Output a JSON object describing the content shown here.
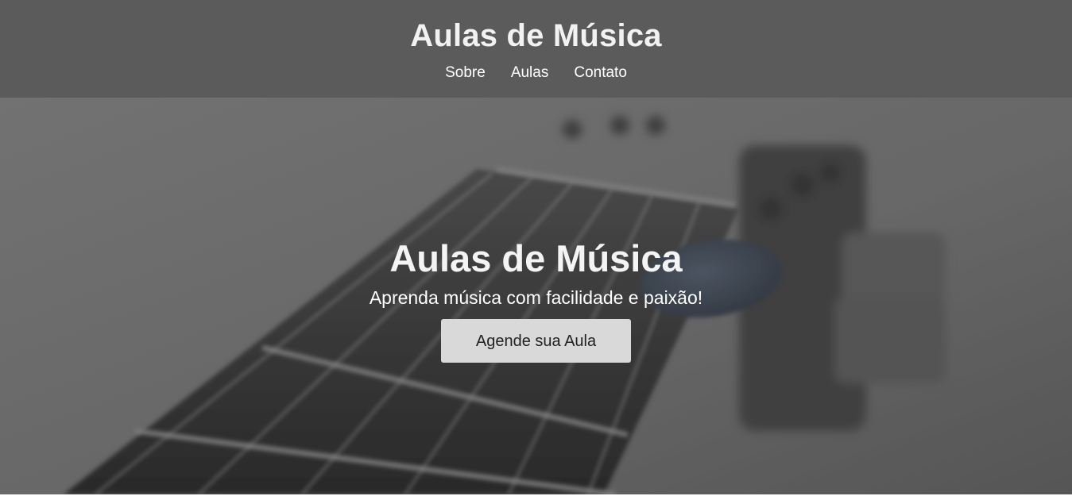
{
  "header": {
    "site_title": "Aulas de Música",
    "nav": [
      {
        "label": "Sobre"
      },
      {
        "label": "Aulas"
      },
      {
        "label": "Contato"
      }
    ]
  },
  "hero": {
    "background_image": "guitar-fretboard-with-pick-photo",
    "title": "Aulas de Música",
    "subtitle": "Aprenda música com facilidade e paixão!",
    "cta_label": "Agende sua Aula"
  },
  "colors": {
    "header_bg": "#5b5b5b",
    "button_bg": "#d9d9d9",
    "text_light": "#ffffff"
  }
}
